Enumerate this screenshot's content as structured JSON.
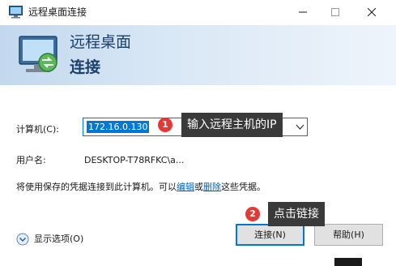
{
  "window": {
    "title": "远程桌面连接",
    "controls": {
      "minimize": "minimize",
      "maximize": "maximize",
      "close": "close"
    }
  },
  "banner": {
    "line1": "远程桌面",
    "line2": "连接"
  },
  "form": {
    "computer_label": "计算机(C):",
    "computer_value": "172.16.0.130",
    "username_label": "用户名:",
    "username_value": "DESKTOP-T78RFKC\\a..."
  },
  "info": {
    "prefix": "将使用保存的凭据连接到此计算机。可以",
    "edit_link": "编辑",
    "or": "或",
    "delete_link": "删除",
    "suffix": "这些凭据。"
  },
  "options": {
    "label": "显示选项(O)"
  },
  "buttons": {
    "connect": "连接(N)",
    "help": "帮助(H)"
  },
  "callouts": [
    {
      "number": "1",
      "text": "输入远程主机的IP"
    },
    {
      "number": "2",
      "text": "点击链接"
    }
  ],
  "colors": {
    "accent": "#0078d7",
    "badge": "#e53935",
    "tooltip": "#3a3a3a",
    "banner_start": "#c2d8ee",
    "banner_end": "#eef4fb",
    "link": "#0066cc"
  },
  "icons": {
    "app": "remote-desktop-icon",
    "banner": "remote-desktop-logo-icon",
    "combo_arrow": "chevron-down-icon",
    "options": "expand-circle-icon"
  }
}
